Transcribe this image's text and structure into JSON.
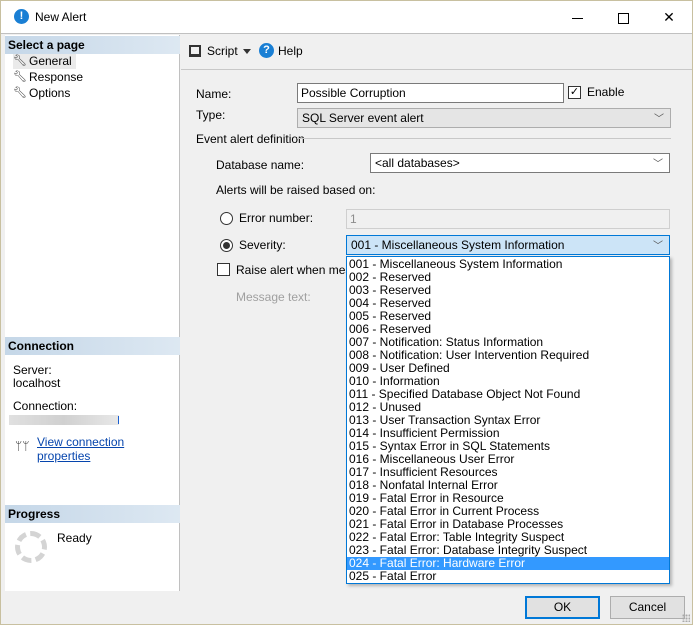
{
  "window": {
    "title": "New Alert",
    "icon": "alert-info-icon",
    "controls": [
      "minimize",
      "maximize",
      "close"
    ]
  },
  "sidebar": {
    "select_page_header": "Select a page",
    "pages": [
      {
        "label": "General",
        "icon": "wrench-icon",
        "selected": true
      },
      {
        "label": "Response",
        "icon": "wrench-icon",
        "selected": false
      },
      {
        "label": "Options",
        "icon": "wrench-icon",
        "selected": false
      }
    ],
    "connection": {
      "header": "Connection",
      "server_label": "Server:",
      "server_value": "localhost",
      "connection_label": "Connection:",
      "view_properties_link": "View connection properties"
    },
    "progress": {
      "header": "Progress",
      "status": "Ready"
    }
  },
  "toolbar": {
    "script_label": "Script",
    "help_label": "Help"
  },
  "form": {
    "name_label": "Name:",
    "name_value": "Possible Corruption",
    "enable_label": "Enable",
    "enable_checked": true,
    "type_label": "Type:",
    "type_value": "SQL Server event alert",
    "event_definition_label": "Event alert definition",
    "database_name_label": "Database name:",
    "database_name_value": "<all databases>",
    "raised_based_on_label": "Alerts will be raised based on:",
    "error_number_label": "Error number:",
    "error_number_value": "1",
    "error_number_selected": false,
    "severity_label": "Severity:",
    "severity_value": "001 - Miscellaneous System Information",
    "severity_selected": true,
    "raise_alert_label": "Raise alert when message contains:",
    "raise_alert_visible_label": "Raise alert when messa",
    "raise_alert_checked": false,
    "message_text_label": "Message text:"
  },
  "severity_dropdown": {
    "highlighted_index": 23,
    "options": [
      "001 - Miscellaneous System Information",
      "002 - Reserved",
      "003 - Reserved",
      "004 - Reserved",
      "005 - Reserved",
      "006 - Reserved",
      "007 - Notification: Status Information",
      "008 - Notification: User Intervention Required",
      "009 - User Defined",
      "010 - Information",
      "011 - Specified Database Object Not Found",
      "012 - Unused",
      "013 - User Transaction Syntax Error",
      "014 - Insufficient Permission",
      "015 - Syntax Error in SQL Statements",
      "016 - Miscellaneous User Error",
      "017 - Insufficient Resources",
      "018 - Nonfatal Internal Error",
      "019 - Fatal Error in Resource",
      "020 - Fatal Error in Current Process",
      "021 - Fatal Error in Database Processes",
      "022 - Fatal Error: Table Integrity Suspect",
      "023 - Fatal Error: Database Integrity Suspect",
      "024 - Fatal Error: Hardware Error",
      "025 - Fatal Error"
    ]
  },
  "buttons": {
    "ok": "OK",
    "cancel": "Cancel"
  },
  "colors": {
    "accent": "#0078d7",
    "highlight": "#3399ff",
    "link": "#0645ad",
    "section_header": "#c5d7e8"
  }
}
